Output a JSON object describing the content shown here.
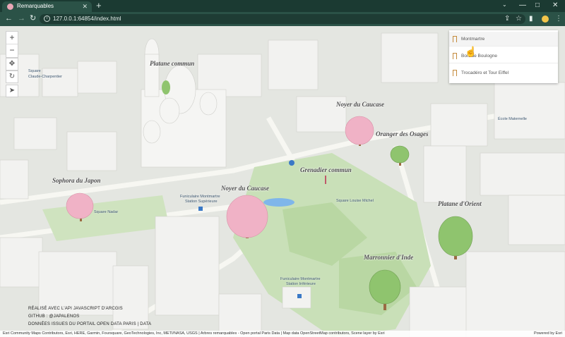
{
  "browser": {
    "tab_title": "Remarquables",
    "tab_close": "✕",
    "new_tab": "+",
    "url": "127.0.0.1:64854/index.html",
    "win_min": "—",
    "win_max": "□",
    "win_close": "✕"
  },
  "map": {
    "tree_labels": [
      {
        "text": "Platane commun"
      },
      {
        "text": "Noyer du Caucase"
      },
      {
        "text": "Oranger des Osages"
      },
      {
        "text": "Grenadier commun"
      },
      {
        "text": "Sophora du Japon"
      },
      {
        "text": "Noyer du Caucase"
      },
      {
        "text": "Platane d'Orient"
      },
      {
        "text": "Marronnier d'Inde"
      }
    ],
    "place_labels": [
      {
        "text": "Square"
      },
      {
        "text": "Claude-Charpentier"
      },
      {
        "text": "Square Nadar"
      },
      {
        "text": "Funiculaire Montmartre"
      },
      {
        "text": "Station Supérieure"
      },
      {
        "text": "Square Louise Michel"
      },
      {
        "text": "Funiculaire Montmartre"
      },
      {
        "text": "Station Inférieure"
      },
      {
        "text": "École Maternelle"
      }
    ],
    "zoom_in": "+",
    "zoom_out": "−"
  },
  "bookmarks": [
    {
      "label": "Montmartre"
    },
    {
      "label": "Bois de Boulogne"
    },
    {
      "label": "Trocadéro et Tour Eiffel"
    }
  ],
  "credits": {
    "line1": "RÉALISÉ AVEC L'API JAVASCRIPT D'ARCGIS",
    "line2": "GITHUB : @JAPALENOS",
    "line3": "DONNÉES ISSUES DU PORTAIL OPEN DATA PARIS | DATA"
  },
  "attribution": {
    "text": "Esri Community Maps Contributors, Esri, HERE, Garmin, Foursquare, GeoTechnologies, Inc, METI/NASA, USGS | Arbres remarquables - Open portal Paris Data | Map data OpenStreetMap contributors, Scene layer by Esri",
    "powered": "Powered by Esri"
  },
  "colors": {
    "chrome_dark": "#1b3a32",
    "chrome": "#2b5247",
    "park": "#c9e0b8",
    "tree_pink": "#f0b2c6",
    "tree_green": "#8fc46e"
  }
}
